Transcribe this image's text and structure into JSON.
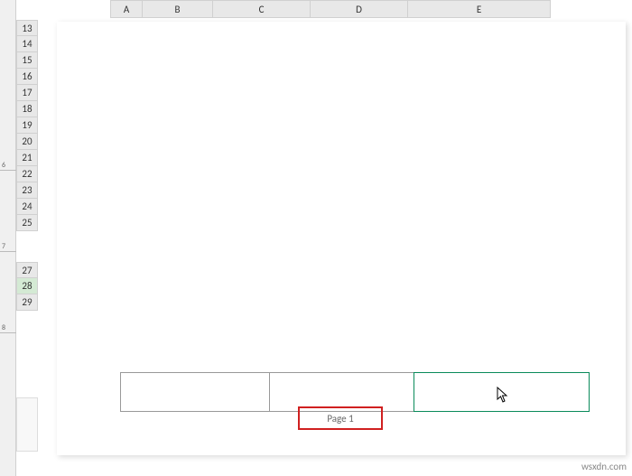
{
  "columns": {
    "A": "A",
    "B": "B",
    "C": "C",
    "D": "D",
    "E": "E"
  },
  "rows": {
    "group1": [
      "13",
      "14",
      "15",
      "16",
      "17",
      "18",
      "19",
      "20",
      "21",
      "22",
      "23",
      "24",
      "25"
    ],
    "group2": [
      "27",
      "28",
      "29"
    ]
  },
  "selected_row": "28",
  "vruler": {
    "marks": [
      "6",
      "7",
      "8"
    ]
  },
  "footer": {
    "left": "",
    "center": "",
    "right": "",
    "page_label": "Page 1",
    "active_section": "right"
  },
  "annotation": {
    "highlight_color": "#d02020",
    "active_border_color": "#0a8a5a"
  },
  "watermark": "wsxdn.com"
}
